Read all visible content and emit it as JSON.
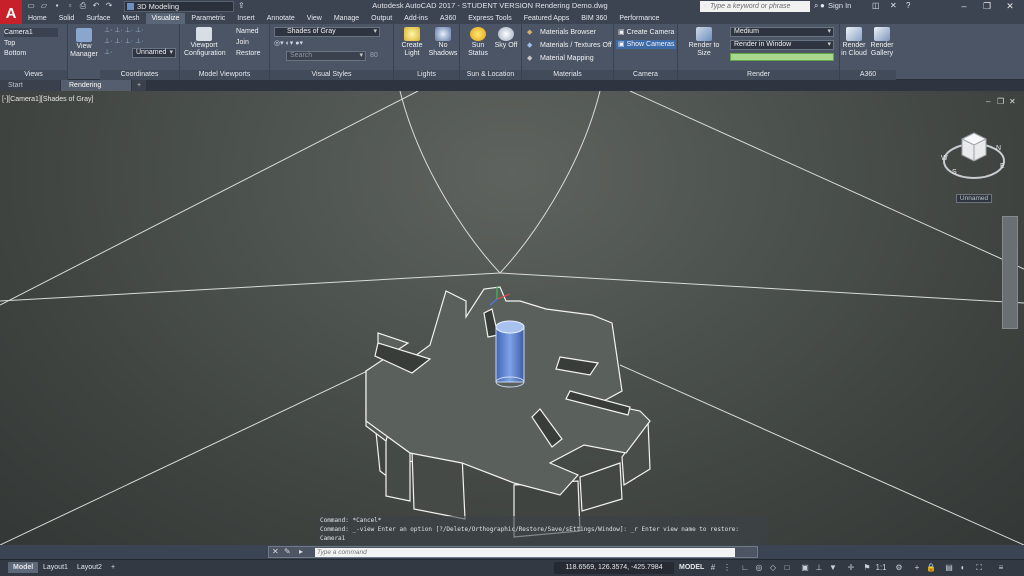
{
  "titlebar": {
    "logo_letter": "A",
    "workspace": "3D Modeling",
    "window_title": "Autodesk AutoCAD 2017 - STUDENT VERSION    Rendering Demo.dwg",
    "search_placeholder": "Type a keyword or phrase",
    "sign_in": "Sign In"
  },
  "ribbon_tabs": [
    "Home",
    "Solid",
    "Surface",
    "Mesh",
    "Visualize",
    "Parametric",
    "Insert",
    "Annotate",
    "View",
    "Manage",
    "Output",
    "Add-ins",
    "A360",
    "Express Tools",
    "Featured Apps",
    "BIM 360",
    "Performance"
  ],
  "active_tab": "Visualize",
  "ribbon": {
    "views": {
      "title": "Views",
      "items": [
        "Camera1",
        "Top",
        "Bottom"
      ],
      "view_manager": "View Manager"
    },
    "coordinates": {
      "title": "Coordinates",
      "ucs_name": "Unnamed"
    },
    "model_viewports": {
      "title": "Model Viewports",
      "config": "Viewport Configuration",
      "named": "Named",
      "join": "Join",
      "restore": "Restore"
    },
    "visual_styles": {
      "title": "Visual Styles",
      "current": "Shades of Gray",
      "filter_placeholder": "Search",
      "filter_suffix": "80"
    },
    "lights": {
      "title": "Lights",
      "create_light": "Create Light",
      "no_shadows": "No Shadows"
    },
    "sun": {
      "title": "Sun & Location",
      "sun_status": "Sun Status",
      "sky_off": "Sky Off"
    },
    "materials": {
      "title": "Materials",
      "browser": "Materials Browser",
      "textures": "Materials / Textures Off",
      "mapping": "Material Mapping"
    },
    "camera": {
      "title": "Camera",
      "create": "Create Camera",
      "show": "Show Cameras"
    },
    "render": {
      "title": "Render",
      "render_to_size": "Render to Size",
      "quality": "Medium",
      "target": "Render in Window"
    },
    "a360": {
      "title": "A360",
      "cloud": "Render in Cloud",
      "gallery": "Render Gallery"
    }
  },
  "file_tabs": [
    "Start",
    "Rendering Demo*"
  ],
  "viewport": {
    "label": "[-][Camera1][Shades of Gray]",
    "wcs": "Unnamed",
    "nav_n": "N",
    "nav_s": "S",
    "nav_w": "W",
    "nav_e": "E"
  },
  "command": {
    "history": [
      "Command: *Cancel*",
      "Command: _-view Enter an option [?/Delete/Orthographic/Restore/Save/sEttings/Window]: _r Enter view name to restore:",
      "Camera1"
    ],
    "placeholder": "Type a command"
  },
  "status": {
    "layouts": [
      "Model",
      "Layout1",
      "Layout2"
    ],
    "coords": "118.6569, 126.3574, -425.7984",
    "mode": "MODEL",
    "scale": "1:1"
  }
}
